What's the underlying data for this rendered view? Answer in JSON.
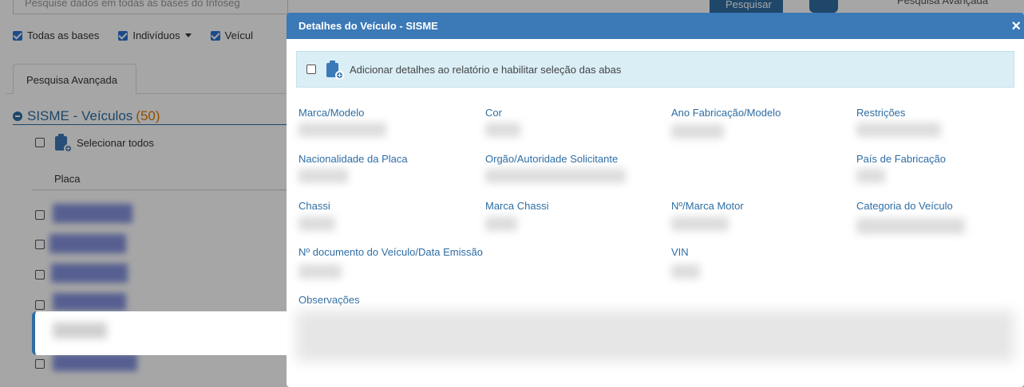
{
  "background": {
    "search_placeholder": "Pesquise dados em todas as bases do Infoseg",
    "search_button_label": "Pesquisar",
    "advanced_link": "Pesquisa Avançada",
    "filters": [
      {
        "label": "Todas as bases"
      },
      {
        "label": "Indivíduos"
      },
      {
        "label": "Veícul"
      }
    ],
    "tab_label": "Pesquisa Avançada",
    "section_title": "SISME - Veículos",
    "section_count": "(50)",
    "select_all_label": "Selecionar todos",
    "column_header": "Placa"
  },
  "modal": {
    "title": "Detalhes do Veículo - SISME",
    "close_label": "×",
    "add_details_label": "Adicionar detalhes ao relatório e habilitar seleção das abas",
    "fields": {
      "marca_modelo": "Marca/Modelo",
      "cor": "Cor",
      "ano": "Ano Fabricação/Modelo",
      "restricoes": "Restrições",
      "nacionalidade": "Nacionalidade da Placa",
      "orgao": "Orgão/Autoridade Solicitante",
      "pais": "País de Fabricação",
      "chassi": "Chassi",
      "marca_chassi": "Marca Chassi",
      "motor": "Nº/Marca Motor",
      "categoria": "Categoria do Veículo",
      "documento": "Nº documento do Veículo/Data Emissão",
      "vin": "VIN",
      "observacoes": "Observações"
    }
  },
  "icons": [
    "clipboard-plus-icon",
    "close-icon",
    "minus-circle-icon",
    "caret-down-icon",
    "checkbox-icon"
  ],
  "colors": {
    "header_blue": "#3b79b7",
    "label_blue": "#2e6da4",
    "count_orange": "#e07b00",
    "alert_bg": "#daeef6"
  }
}
